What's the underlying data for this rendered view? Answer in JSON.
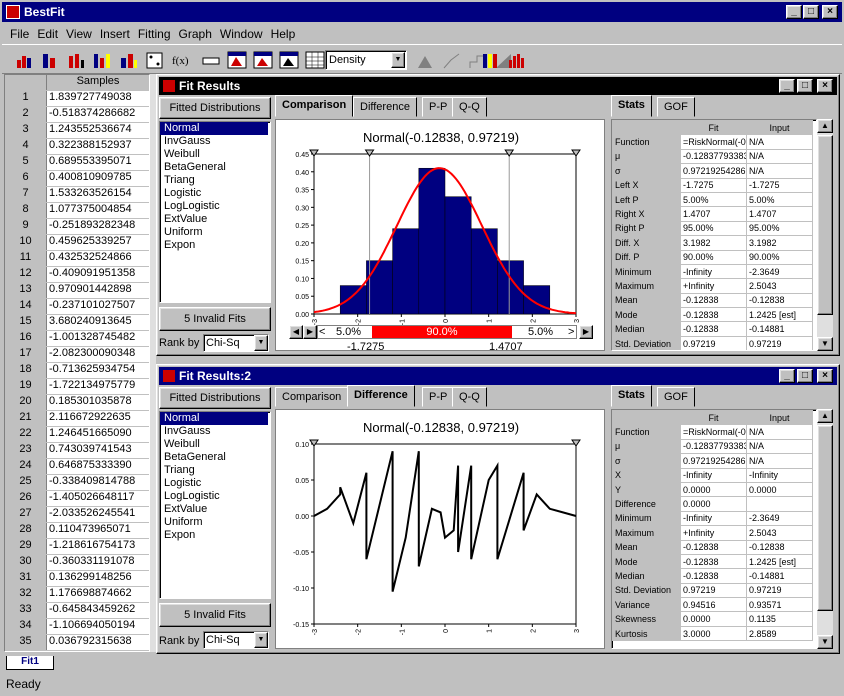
{
  "app": {
    "title": "BestFit"
  },
  "menu": [
    "File",
    "Edit",
    "View",
    "Insert",
    "Fitting",
    "Graph",
    "Window",
    "Help"
  ],
  "toolbar": {
    "graph_type": "Density"
  },
  "samples": {
    "header": "Samples",
    "rows": [
      [
        "1",
        "1.839727749038"
      ],
      [
        "2",
        "-0.518374286682"
      ],
      [
        "3",
        "1.243552536674"
      ],
      [
        "4",
        "0.322388152937"
      ],
      [
        "5",
        "0.689553395071"
      ],
      [
        "6",
        "0.400810909785"
      ],
      [
        "7",
        "1.533263526154"
      ],
      [
        "8",
        "1.077375004854"
      ],
      [
        "9",
        "-0.251893282348"
      ],
      [
        "10",
        "0.459625339257"
      ],
      [
        "11",
        "0.432532524866"
      ],
      [
        "12",
        "-0.409091951358"
      ],
      [
        "13",
        "0.970901442898"
      ],
      [
        "14",
        "-0.237101027507"
      ],
      [
        "15",
        "3.680240913645"
      ],
      [
        "16",
        "-1.001328745482"
      ],
      [
        "17",
        "-2.082300090348"
      ],
      [
        "18",
        "-0.713625934754"
      ],
      [
        "19",
        "-1.722134975779"
      ],
      [
        "20",
        "0.185301035878"
      ],
      [
        "21",
        "2.116672922635"
      ],
      [
        "22",
        "1.246451665090"
      ],
      [
        "23",
        "0.743039741543"
      ],
      [
        "24",
        "0.646875333390"
      ],
      [
        "25",
        "-0.338409814788"
      ],
      [
        "26",
        "-1.405026648117"
      ],
      [
        "27",
        "-2.033526245541"
      ],
      [
        "28",
        "0.110473965071"
      ],
      [
        "29",
        "-1.218616754173"
      ],
      [
        "30",
        "-0.360331191078"
      ],
      [
        "31",
        "0.136299148256"
      ],
      [
        "32",
        "1.176698874662"
      ],
      [
        "33",
        "-0.645843459262"
      ],
      [
        "34",
        "-1.106694050194"
      ],
      [
        "35",
        "0.036792315638"
      ]
    ]
  },
  "sheet_tab": "Fit1",
  "status": "Ready",
  "fit1": {
    "title": "Fit Results",
    "fitted_header": "Fitted Distributions",
    "distributions": [
      "Normal",
      "InvGauss",
      "Weibull",
      "BetaGeneral",
      "Triang",
      "Logistic",
      "LogLogistic",
      "ExtValue",
      "Uniform",
      "Expon"
    ],
    "selected": "Normal",
    "invalid_fits": "5 Invalid Fits",
    "rank_label": "Rank by",
    "rank_value": "Chi-Sq",
    "tabs": [
      "Comparison",
      "Difference",
      "P-P",
      "Q-Q"
    ],
    "active_tab": "Comparison",
    "chart_title": "Normal(-0.12838, 0.97219)",
    "stats_tabs": [
      "Stats",
      "GOF"
    ],
    "stats_header": [
      "",
      "Fit",
      "Input"
    ],
    "stats_rows": [
      [
        "Function",
        "=RiskNormal(-0",
        "N/A"
      ],
      [
        "μ",
        "-0.12837793383",
        "N/A"
      ],
      [
        "σ",
        "0.97219254286",
        "N/A"
      ],
      [
        "Left X",
        "-1.7275",
        "-1.7275"
      ],
      [
        "Left P",
        "5.00%",
        "5.00%"
      ],
      [
        "Right X",
        "1.4707",
        "1.4707"
      ],
      [
        "Right P",
        "95.00%",
        "95.00%"
      ],
      [
        "Diff. X",
        "3.1982",
        "3.1982"
      ],
      [
        "Diff. P",
        "90.00%",
        "90.00%"
      ],
      [
        "Minimum",
        "-Infinity",
        "-2.3649"
      ],
      [
        "Maximum",
        "+Infinity",
        "2.5043"
      ],
      [
        "Mean",
        "-0.12838",
        "-0.12838"
      ],
      [
        "Mode",
        "-0.12838",
        "1.2425 [est]"
      ],
      [
        "Median",
        "-0.12838",
        "-0.14881"
      ],
      [
        "Std. Deviation",
        "0.97219",
        "0.97219"
      ]
    ],
    "slider": {
      "left_pct": "5.0%",
      "mid_pct": "90.0%",
      "right_pct": "5.0%",
      "left_val": "-1.7275",
      "right_val": "1.4707",
      "lt": "<",
      "gt": ">"
    }
  },
  "fit2": {
    "title": "Fit Results:2",
    "fitted_header": "Fitted Distributions",
    "distributions": [
      "Normal",
      "InvGauss",
      "Weibull",
      "BetaGeneral",
      "Triang",
      "Logistic",
      "LogLogistic",
      "ExtValue",
      "Uniform",
      "Expon"
    ],
    "selected": "Normal",
    "invalid_fits": "5 Invalid Fits",
    "rank_label": "Rank by",
    "rank_value": "Chi-Sq",
    "tabs": [
      "Comparison",
      "Difference",
      "P-P",
      "Q-Q"
    ],
    "active_tab": "Difference",
    "chart_title": "Normal(-0.12838, 0.97219)",
    "stats_tabs": [
      "Stats",
      "GOF"
    ],
    "stats_header": [
      "",
      "Fit",
      "Input"
    ],
    "stats_rows": [
      [
        "Function",
        "=RiskNormal(-0",
        "N/A"
      ],
      [
        "μ",
        "-0.12837793383",
        "N/A"
      ],
      [
        "σ",
        "0.97219254286",
        "N/A"
      ],
      [
        "X",
        "-Infinity",
        "-Infinity"
      ],
      [
        "Y",
        "0.0000",
        "0.0000"
      ],
      [
        "Difference",
        "0.0000",
        ""
      ],
      [
        "Minimum",
        "-Infinity",
        "-2.3649"
      ],
      [
        "Maximum",
        "+Infinity",
        "2.5043"
      ],
      [
        "Mean",
        "-0.12838",
        "-0.12838"
      ],
      [
        "Mode",
        "-0.12838",
        "1.2425 [est]"
      ],
      [
        "Median",
        "-0.12838",
        "-0.14881"
      ],
      [
        "Std. Deviation",
        "0.97219",
        "0.97219"
      ],
      [
        "Variance",
        "0.94516",
        "0.93571"
      ],
      [
        "Skewness",
        "0.0000",
        "0.1135"
      ],
      [
        "Kurtosis",
        "3.0000",
        "2.8589"
      ]
    ]
  },
  "chart_data": [
    {
      "type": "bar",
      "title": "Normal(-0.12838, 0.97219)",
      "x_ticks": [
        "-3",
        "-2",
        "-1",
        "0",
        "1",
        "2",
        "3"
      ],
      "y_ticks": [
        "0.45",
        "0.40",
        "0.35",
        "0.30",
        "0.25",
        "0.20",
        "0.15",
        "0.10",
        "0.05",
        "0.00"
      ],
      "ylim": [
        0,
        0.45
      ],
      "xlim": [
        -3,
        3
      ],
      "bins": [
        [
          -2.4,
          -1.8,
          0.08
        ],
        [
          -1.8,
          -1.2,
          0.15
        ],
        [
          -1.2,
          -0.6,
          0.24
        ],
        [
          -0.6,
          0,
          0.41
        ],
        [
          0,
          0.6,
          0.33
        ],
        [
          0.6,
          1.2,
          0.24
        ],
        [
          1.2,
          1.8,
          0.15
        ],
        [
          1.8,
          2.4,
          0.08
        ]
      ],
      "curve": {
        "type": "line",
        "mu": -0.12838,
        "sigma": 0.97219
      },
      "colors": {
        "bar": "#000080",
        "curve": "#ff0000"
      }
    },
    {
      "type": "line",
      "title": "Normal(-0.12838, 0.97219)",
      "x_ticks": [
        "-3",
        "-2",
        "-1",
        "0",
        "1",
        "2",
        "3"
      ],
      "y_ticks": [
        "0.10",
        "0.05",
        "0.00",
        "-0.05",
        "-0.10",
        "-0.15"
      ],
      "ylim": [
        -0.15,
        0.1
      ],
      "xlim": [
        -3,
        3
      ],
      "points": [
        [
          -3,
          0
        ],
        [
          -2.7,
          0.01
        ],
        [
          -2.4,
          0.03
        ],
        [
          -2.4,
          0.04
        ],
        [
          -2.1,
          -0.01
        ],
        [
          -1.8,
          0.06
        ],
        [
          -1.8,
          -0.06
        ],
        [
          -1.2,
          0.09
        ],
        [
          -1.2,
          -0.105
        ],
        [
          -0.9,
          -0.03
        ],
        [
          -0.6,
          0.09
        ],
        [
          -0.6,
          -0.07
        ],
        [
          -0.3,
          0.01
        ],
        [
          -0.1,
          0.005
        ],
        [
          0,
          -0.03
        ],
        [
          0.2,
          -0.02
        ],
        [
          0.3,
          0.07
        ],
        [
          0.3,
          -0.05
        ],
        [
          0.6,
          0.07
        ],
        [
          0.6,
          -0.06
        ],
        [
          1.0,
          0.05
        ],
        [
          1.2,
          0.07
        ],
        [
          1.2,
          -0.06
        ],
        [
          1.8,
          0.06
        ],
        [
          1.8,
          -0.02
        ],
        [
          2.1,
          0.03
        ],
        [
          2.4,
          0.01
        ],
        [
          2.7,
          0.005
        ],
        [
          3,
          0
        ]
      ],
      "colors": {
        "line": "#000000"
      }
    }
  ]
}
